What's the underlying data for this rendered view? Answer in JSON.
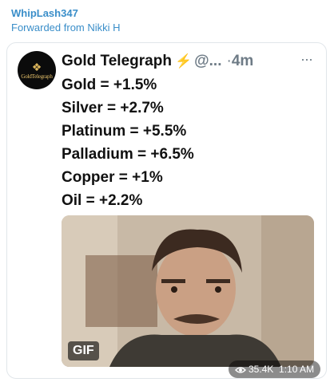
{
  "message": {
    "sender": "WhipLash347",
    "forwarded_from": "Forwarded from Nikki H"
  },
  "tweet": {
    "avatar_text": "GoldTelegraph",
    "author": "Gold Telegraph",
    "verified_emoji": "⚡",
    "handle": "@...",
    "separator": "·",
    "time": "4m",
    "more": "···",
    "lines": [
      "Gold = +1.5%",
      "Silver = +2.7%",
      "Platinum = +5.5%",
      "Palladium = +6.5%",
      "Copper = +1%",
      "Oil = +2.2%"
    ],
    "gif_badge": "GIF"
  },
  "meta": {
    "views": "35.4K",
    "time": "1:10 AM"
  },
  "colors": {
    "sender": "#3a8ec9",
    "text": "#111111",
    "muted": "#6e7b86",
    "bolt": "#f2b318"
  }
}
